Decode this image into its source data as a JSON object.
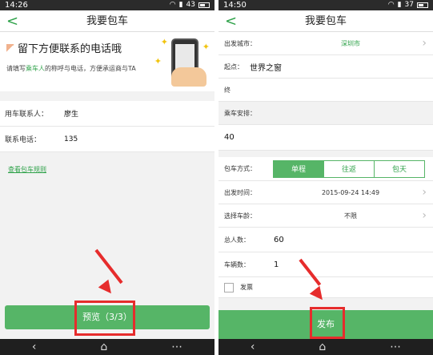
{
  "left": {
    "status": {
      "time": "14:26",
      "battery": "43"
    },
    "title": "我要包车",
    "banner": {
      "headline": "留下方便联系的电话哦",
      "sub_prefix": "请填写",
      "sub_highlight": "乘车人",
      "sub_suffix": "的称呼与电话，方便承运商与TA"
    },
    "form": {
      "contact_label": "用车联系人：",
      "contact_value": "廖生",
      "phone_label": "联系电话：",
      "phone_value": "135"
    },
    "rules_link": "查看包车规则",
    "preview_button": "预览（3/3）"
  },
  "right": {
    "status": {
      "time": "14:50",
      "battery": "37"
    },
    "title": "我要包车",
    "rows": {
      "city_label": "出发城市：",
      "city_value": "深圳市",
      "start_label": "起点：",
      "start_value": "世界之窗",
      "end_label": "终",
      "arrange_label": "乘车安排：",
      "arrange_value": "40",
      "mode_label": "包车方式：",
      "mode_options": [
        "单程",
        "往返",
        "包天"
      ],
      "depart_label": "出发时间：",
      "depart_value": "2015-09-24 14:49",
      "age_label": "选择车龄：",
      "age_value": "不限",
      "people_label": "总人数：",
      "people_value": "60",
      "cars_label": "车辆数：",
      "cars_value": "1",
      "invoice_label": "发票"
    },
    "publish_button": "发布"
  },
  "colors": {
    "accent": "#56b567",
    "annotation": "#e62c2c"
  }
}
